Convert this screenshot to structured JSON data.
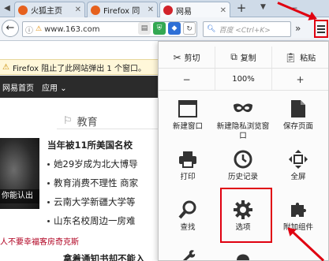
{
  "tabs": [
    {
      "label": "火狐主页",
      "favicon_color": "#e6611e"
    },
    {
      "label": "Firefox 同",
      "favicon_color": "#e6611e"
    },
    {
      "label": "网易",
      "favicon_color": "#d2222a"
    }
  ],
  "navbar": {
    "url": "www.163.com",
    "search_placeholder": "百度 <Ctrl+K>"
  },
  "notification": "Firefox 阻止了此网站弹出 1 个窗口。",
  "page": {
    "nav": [
      "网易首页",
      "应用"
    ],
    "section_title": "教育",
    "headlines": [
      "当年被11所美国名校",
      "她29岁成为北大博导",
      "教育消费不理性 商家",
      "云南大学新疆大学等",
      "山东名校周边一房难",
      "拿着通知书却不能入"
    ],
    "photo_caption": "你能认出",
    "byline": "人不要幸福客房奇克斯"
  },
  "menu": {
    "edit_row": {
      "cut": "剪切",
      "copy": "复制",
      "paste": "粘贴"
    },
    "zoom_row": {
      "minus": "−",
      "level": "100%",
      "plus": "+"
    },
    "items": [
      {
        "label": "新建窗口"
      },
      {
        "label": "新建隐私浏览窗口"
      },
      {
        "label": "保存页面"
      },
      {
        "label": "打印"
      },
      {
        "label": "历史记录"
      },
      {
        "label": "全屏"
      },
      {
        "label": "查找"
      },
      {
        "label": "选项"
      },
      {
        "label": "附加组件"
      }
    ]
  },
  "colors": {
    "callout": "#e00010"
  }
}
